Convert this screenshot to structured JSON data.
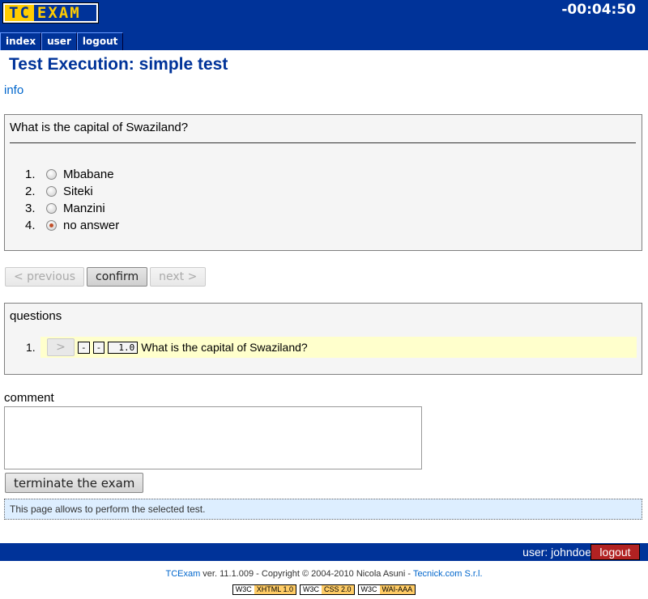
{
  "header": {
    "logo": {
      "left": "TC",
      "right": "EXAM"
    },
    "timer": "-00:04:50",
    "menu": [
      {
        "label": "index"
      },
      {
        "label": "user"
      },
      {
        "label": "logout"
      }
    ]
  },
  "page": {
    "title": "Test Execution: simple test",
    "info_link": "info"
  },
  "question": {
    "text": "What is the capital of Swaziland?",
    "answers": [
      {
        "num": "1.",
        "label": "Mbabane",
        "selected": false
      },
      {
        "num": "2.",
        "label": "Siteki",
        "selected": false
      },
      {
        "num": "3.",
        "label": "Manzini",
        "selected": false
      },
      {
        "num": "4.",
        "label": "no answer",
        "selected": true
      }
    ]
  },
  "navigation": {
    "previous_label": "< previous",
    "confirm_label": "confirm",
    "next_label": "next >"
  },
  "questions_list": {
    "title": "questions",
    "items": [
      {
        "num": "1.",
        "go_label": ">",
        "flag1": "-",
        "flag2": "-",
        "score": "1.0",
        "text": "What is the capital of Swaziland?"
      }
    ]
  },
  "comment": {
    "label": "comment",
    "value": ""
  },
  "terminate_label": "terminate the exam",
  "help_text": "This page allows to perform the selected test.",
  "footer": {
    "user_text": "user: johndoe",
    "logout_label": "logout",
    "copyright": {
      "app_link": "TCExam",
      "middle": " ver. 11.1.009 - Copyright © 2004-2010 Nicola Asuni - ",
      "company_link": "Tecnick.com S.r.l."
    },
    "badges": [
      {
        "w3c": "W3C",
        "label": "XHTML 1.0"
      },
      {
        "w3c": "W3C",
        "label": "CSS 2.0"
      },
      {
        "w3c": "W3C",
        "label": "WAI-AAA"
      }
    ]
  },
  "colors": {
    "brand_blue": "#003399",
    "logo_yellow": "#ffcc00",
    "logout_red": "#b22222",
    "highlight_row": "#ffffcc",
    "help_bg": "#ddeeff"
  }
}
